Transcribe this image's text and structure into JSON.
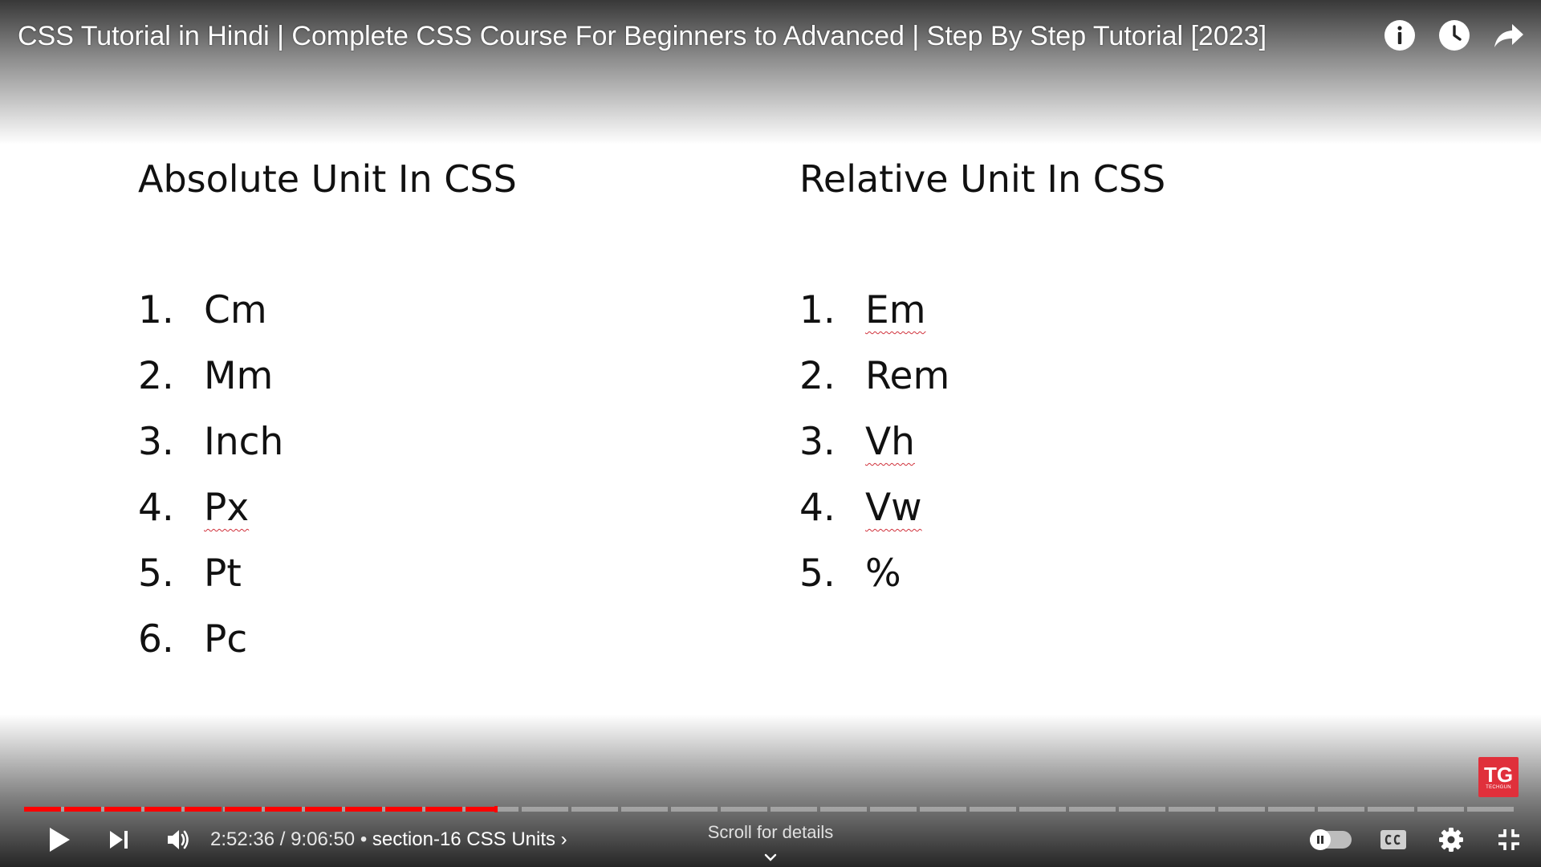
{
  "video": {
    "title": "CSS Tutorial in Hindi | Complete CSS Course For Beginners to Advanced | Step By Step Tutorial [2023]"
  },
  "slide": {
    "left_column": {
      "heading": "Absolute Unit In CSS",
      "items": [
        {
          "num": "1.",
          "name": "Cm"
        },
        {
          "num": "2.",
          "name": "Mm"
        },
        {
          "num": "3.",
          "name": "Inch"
        },
        {
          "num": "4.",
          "name": "Px"
        },
        {
          "num": "5.",
          "name": "Pt"
        },
        {
          "num": "6.",
          "name": "Pc"
        }
      ]
    },
    "right_column": {
      "heading": "Relative Unit In CSS",
      "items": [
        {
          "num": "1.",
          "name": "Em"
        },
        {
          "num": "2.",
          "name": "Rem"
        },
        {
          "num": "3.",
          "name": "Vh"
        },
        {
          "num": "4.",
          "name": "Vw"
        },
        {
          "num": "5.",
          "name": "%"
        }
      ]
    }
  },
  "top_actions": [
    "info-icon",
    "watch-later-icon",
    "share-icon"
  ],
  "channel_badge": {
    "letters": "TG",
    "sub": "TECHGUN",
    "color": "#e0303b"
  },
  "player": {
    "current_time": "2:52:36",
    "duration": "9:06:50",
    "time_display": "2:52:36 / 9:06:50",
    "separator": "•",
    "chapter": "section-16 CSS Units",
    "chapter_chevron": "›",
    "progress_fraction": 0.316,
    "progress_color": "#ff0000",
    "scroll_hint": "Scroll for details"
  },
  "right_controls": [
    "autoplay-toggle",
    "captions-icon",
    "settings-gear-icon",
    "exit-fullscreen-icon"
  ]
}
